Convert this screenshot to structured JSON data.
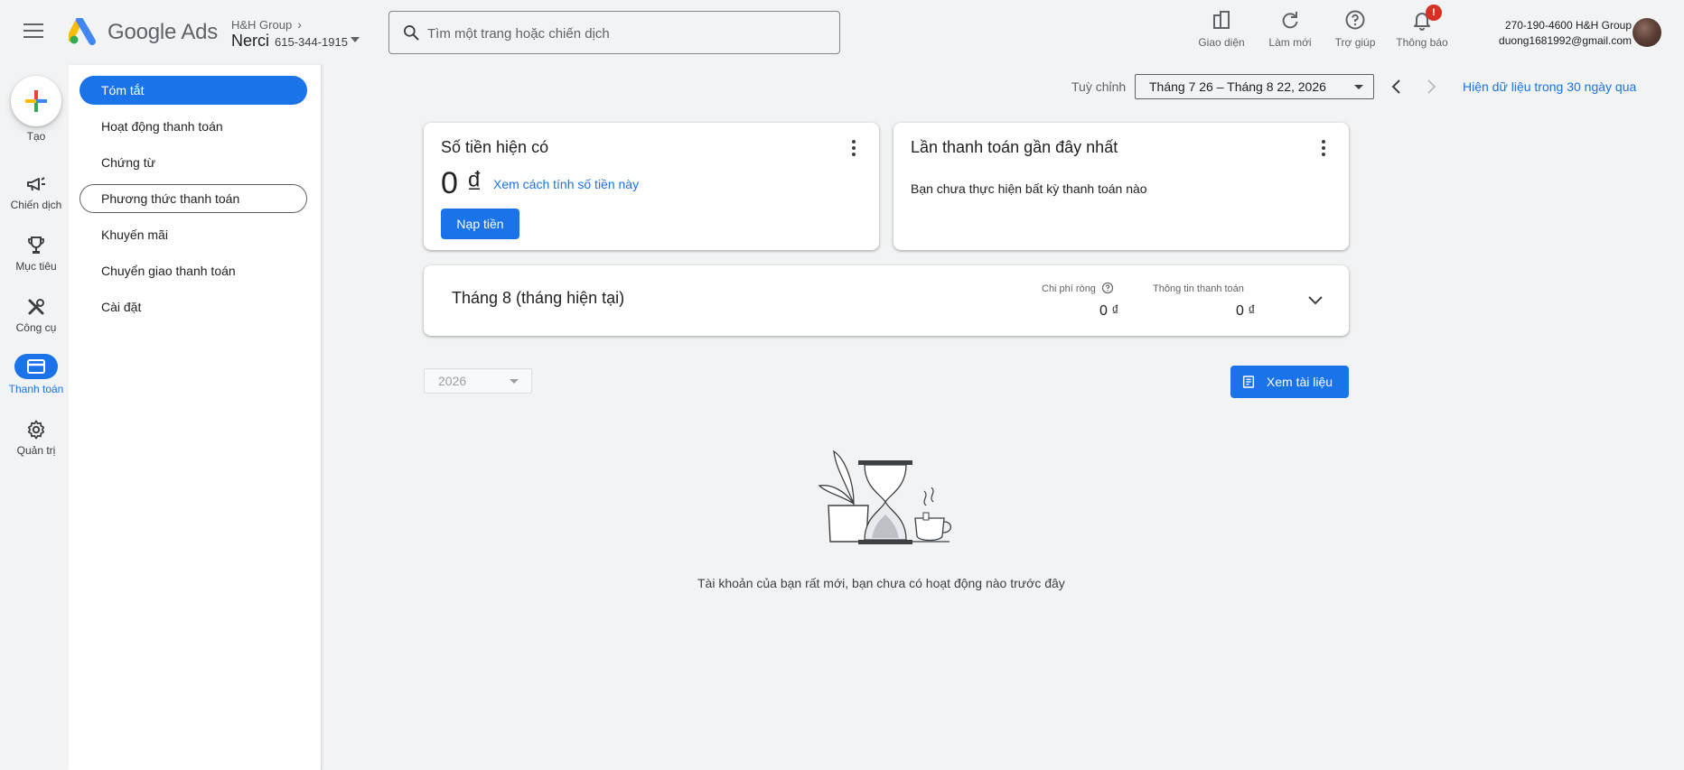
{
  "header": {
    "brand": "Google Ads",
    "account_group": "H&H Group",
    "account_name": "Nerci",
    "account_id": "615-344-1915",
    "search_placeholder": "Tìm một trang hoặc chiến dịch",
    "tools": [
      {
        "label": "Giao diện",
        "icon": "appearance-icon"
      },
      {
        "label": "Làm mới",
        "icon": "refresh-icon"
      },
      {
        "label": "Trợ giúp",
        "icon": "help-icon"
      },
      {
        "label": "Thông báo",
        "icon": "bell-icon",
        "badge": "!"
      }
    ],
    "user_account": "270-190-4600 H&H Group",
    "user_email": "duong1681992@gmail.com"
  },
  "rail": {
    "create_label": "Tạo",
    "items": [
      {
        "label": "Chiến dịch",
        "icon": "megaphone-icon"
      },
      {
        "label": "Mục tiêu",
        "icon": "trophy-icon"
      },
      {
        "label": "Công cụ",
        "icon": "tools-icon"
      },
      {
        "label": "Thanh toán",
        "icon": "credit-card-icon",
        "active": true
      },
      {
        "label": "Quản trị",
        "icon": "gear-icon"
      }
    ]
  },
  "subnav": {
    "items": [
      {
        "label": "Tóm tắt",
        "state": "active"
      },
      {
        "label": "Hoạt động thanh toán"
      },
      {
        "label": "Chứng từ"
      },
      {
        "label": "Phương thức thanh toán",
        "state": "focused"
      },
      {
        "label": "Khuyến mãi"
      },
      {
        "label": "Chuyển giao thanh toán"
      },
      {
        "label": "Cài đặt"
      }
    ]
  },
  "toolbar": {
    "range_label": "Tuỳ chỉnh",
    "date_range": "Tháng 7 26 – Tháng 8 22, 2026",
    "show_30_days": "Hiện dữ liệu trong 30 ngày qua"
  },
  "balance_card": {
    "title": "Số tiền hiện có",
    "amount": "0 ₫",
    "link": "Xem cách tính số tiền này",
    "button": "Nạp tiền"
  },
  "last_payment_card": {
    "title": "Lần thanh toán gần đây nhất",
    "message": "Bạn chưa thực hiện bất kỳ thanh toán nào"
  },
  "month_card": {
    "title": "Tháng 8 (tháng hiện tại)",
    "net_cost_label": "Chi phí ròng",
    "net_cost_value": "0 ₫",
    "billing_info_label": "Thông tin thanh toán",
    "billing_info_value": "0 ₫"
  },
  "documents": {
    "year": "2026",
    "view_button": "Xem tài liệu"
  },
  "empty_state": {
    "message": "Tài khoản của bạn rất mới, bạn chưa có hoạt động nào trước đây"
  },
  "colors": {
    "accent": "#1a73e8",
    "background": "#f1f3f4",
    "badge": "#d93025"
  }
}
